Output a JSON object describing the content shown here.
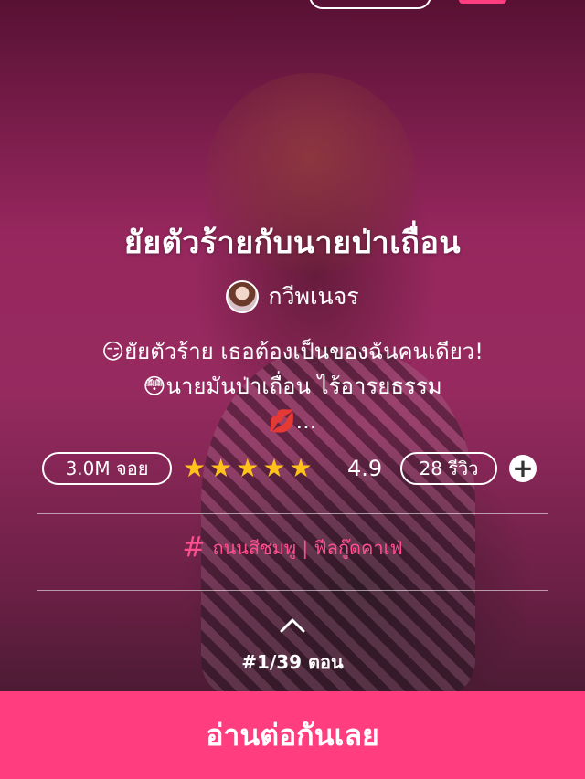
{
  "story": {
    "title": "ยัยตัวร้ายกับนายป่าเถื่อน",
    "author": "กวีพเนจร",
    "synopsis": [
      "😏ยัยตัวร้าย เธอต้องเป็นของฉันคนเดียว!",
      "😳นายมันป่าเถื่อน ไร้อารยธรรม",
      "💋..."
    ]
  },
  "stats": {
    "views": "3.0M จอย",
    "rating": "4.9",
    "stars": 5,
    "reviews": "28 รีวิว"
  },
  "tags": {
    "text": "ถนนสีชมพู | ฟีลกู๊ดคาเฟ่"
  },
  "episode": "#1/39 ตอน",
  "cta_label": "อ่านต่อกันเลย",
  "colors": {
    "accent": "#ff3d7f",
    "tag": "#ff4f8f",
    "star": "#ffc21a"
  },
  "icons": {
    "add": "plus-circle-icon",
    "expand": "chevron-up-icon",
    "tag": "hashtag-icon"
  }
}
